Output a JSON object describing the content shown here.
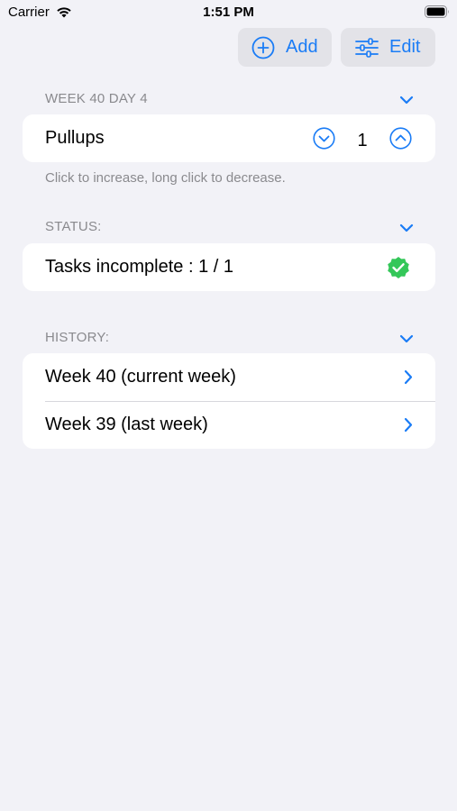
{
  "status_bar": {
    "carrier": "Carrier",
    "time": "1:51 PM"
  },
  "toolbar": {
    "add_label": "Add",
    "edit_label": "Edit"
  },
  "workout": {
    "header": "WEEK 40 DAY 4",
    "exercise": {
      "name": "Pullups",
      "count": "1"
    },
    "footer": "Click to increase, long click to decrease."
  },
  "status": {
    "header": "STATUS:",
    "text": "Tasks incomplete : 1 / 1"
  },
  "history": {
    "header": "HISTORY:",
    "items": [
      {
        "label": "Week 40 (current week)"
      },
      {
        "label": "Week 39 (last week)"
      }
    ]
  },
  "colors": {
    "accent": "#1a7cf6",
    "success": "#34c759",
    "background": "#f2f2f7"
  }
}
